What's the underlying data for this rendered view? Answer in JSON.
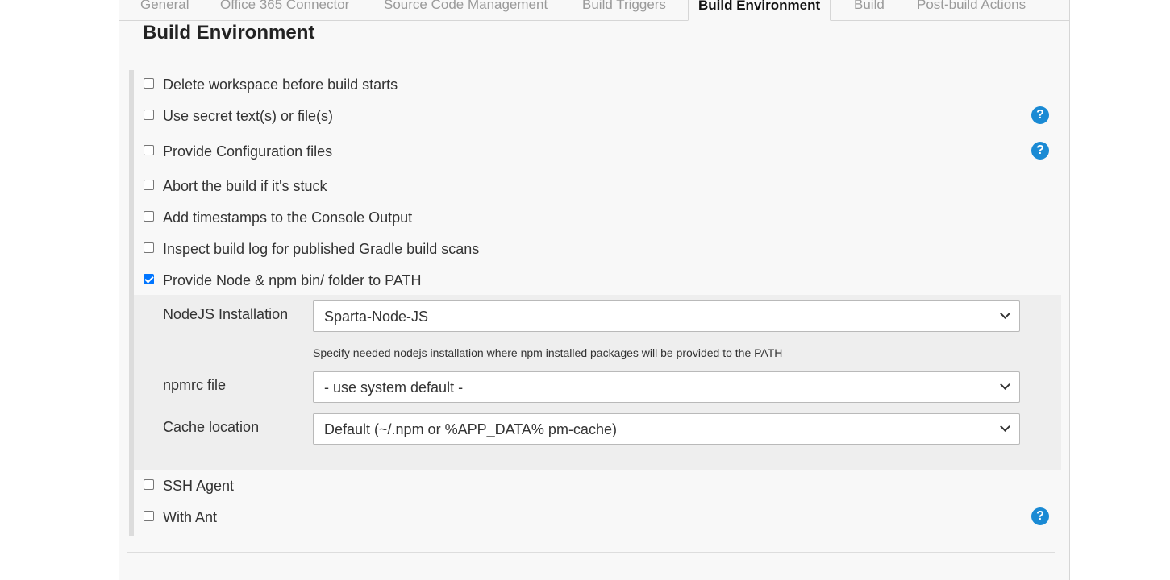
{
  "tabs": [
    {
      "label": "General",
      "active": false
    },
    {
      "label": "Office 365 Connector",
      "active": false
    },
    {
      "label": "Source Code Management",
      "active": false
    },
    {
      "label": "Build Triggers",
      "active": false
    },
    {
      "label": "Build Environment",
      "active": true
    },
    {
      "label": "Build",
      "active": false
    },
    {
      "label": "Post-build Actions",
      "active": false
    }
  ],
  "section": {
    "title": "Build Environment"
  },
  "options": [
    {
      "label": "Delete workspace before build starts",
      "checked": false,
      "help": false
    },
    {
      "label": "Use secret text(s) or file(s)",
      "checked": false,
      "help": true
    },
    {
      "label": "Provide Configuration files",
      "checked": false,
      "help": true
    },
    {
      "label": "Abort the build if it's stuck",
      "checked": false,
      "help": false
    },
    {
      "label": "Add timestamps to the Console Output",
      "checked": false,
      "help": false
    },
    {
      "label": "Inspect build log for published Gradle build scans",
      "checked": false,
      "help": false
    },
    {
      "label": "Provide Node & npm bin/ folder to PATH",
      "checked": true,
      "help": false
    },
    {
      "label": "SSH Agent",
      "checked": false,
      "help": false
    },
    {
      "label": "With Ant",
      "checked": false,
      "help": true
    }
  ],
  "help_icon_glyph": "?",
  "help_icon_name": "question-circle-icon",
  "accent_color": "#1a8ad4",
  "checkbox_color": "#0075ff",
  "node_config": {
    "installation": {
      "label": "NodeJS Installation",
      "value": "Sparta-Node-JS",
      "help_text": "Specify needed nodejs installation where npm installed packages will be provided to the PATH"
    },
    "npmrc": {
      "label": "npmrc file",
      "value": "- use system default -"
    },
    "cache": {
      "label": "Cache location",
      "value": "Default (~/.npm or %APP_DATA% pm-cache)"
    }
  }
}
